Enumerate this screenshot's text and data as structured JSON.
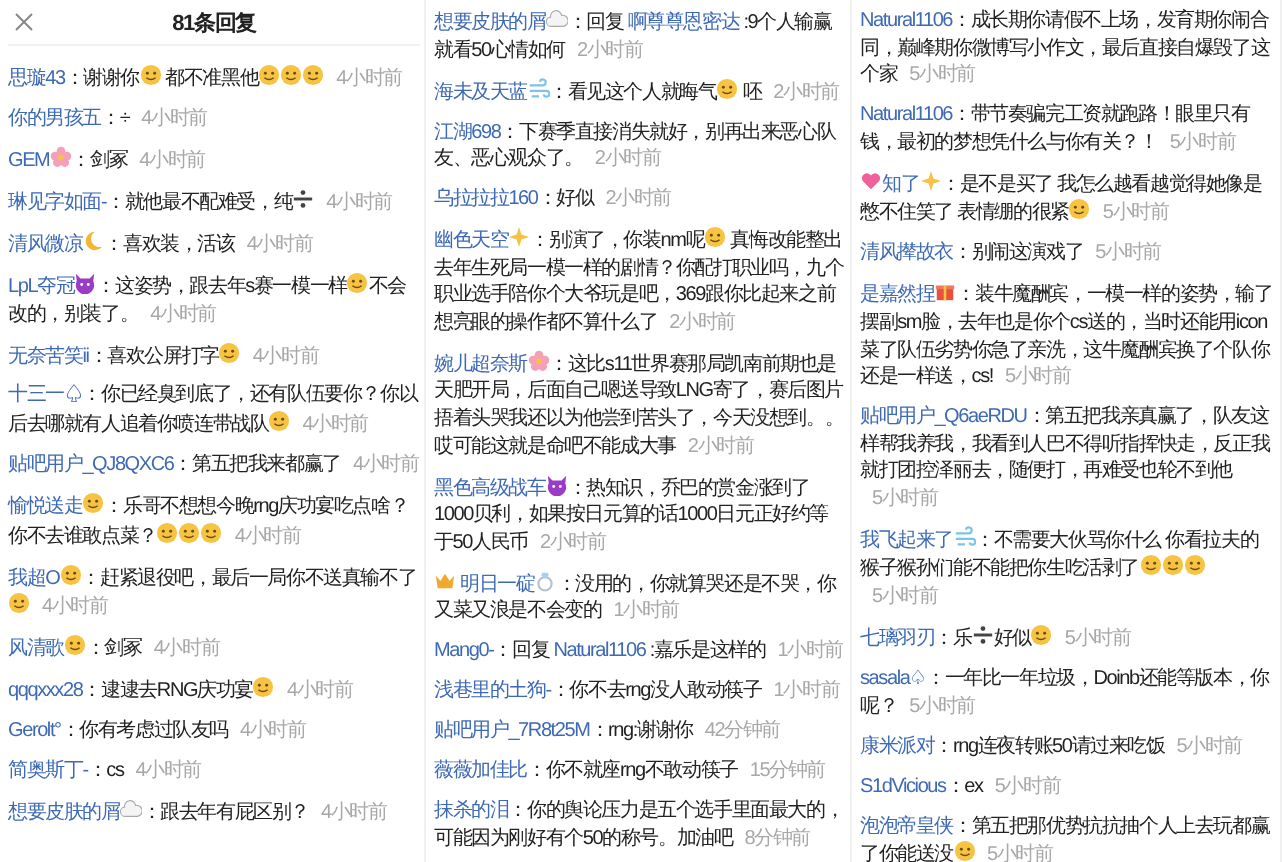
{
  "header": {
    "title": "81条回复"
  },
  "columns": [
    {
      "comments": [
        {
          "user": [
            "思璇43"
          ],
          "body": [
            "：谢谢你",
            {
              "kind": "face"
            },
            " 都不准黑他",
            {
              "kind": "face"
            },
            {
              "kind": "face"
            },
            {
              "kind": "face"
            }
          ],
          "time": "4小时前"
        },
        {
          "user": [
            "你的男孩五"
          ],
          "body": [
            "：÷"
          ],
          "time": "4小时前"
        },
        {
          "user": [
            "GEM",
            {
              "kind": "flower"
            }
          ],
          "body": [
            "：剑冢"
          ],
          "time": "4小时前"
        },
        {
          "user": [
            "琳见字如面-"
          ],
          "body": [
            "：就他最不配难受，纯",
            {
              "kind": "divide"
            }
          ],
          "time": "4小时前"
        },
        {
          "user": [
            "清风微凉",
            {
              "kind": "moon"
            }
          ],
          "body": [
            "：喜欢装，活该"
          ],
          "time": "4小时前"
        },
        {
          "user": [
            "LpL夺冠",
            {
              "kind": "devil"
            }
          ],
          "body": [
            "：这姿势，跟去年s赛一模一样",
            {
              "kind": "face"
            },
            "不会改的，别装了。"
          ],
          "time": "4小时前"
        },
        {
          "user": [
            "无奈苦笑ii"
          ],
          "body": [
            "：喜欢公屏打字",
            {
              "kind": "face"
            }
          ],
          "time": "4小时前"
        },
        {
          "user": [
            "十三一♤"
          ],
          "body": [
            "：你已经臭到底了，还有队伍要你？你以后去哪就有人追着你喷连带战队",
            {
              "kind": "face"
            }
          ],
          "time": "4小时前"
        },
        {
          "user": [
            "贴吧用户_QJ8QXC6"
          ],
          "body": [
            "：第五把我来都赢了"
          ],
          "time": "4小时前"
        },
        {
          "user": [
            "愉悦送走",
            {
              "kind": "face"
            }
          ],
          "body": [
            "：乐哥不想想今晚rng庆功宴吃点啥？你不去谁敢点菜？",
            {
              "kind": "face"
            },
            {
              "kind": "face"
            },
            {
              "kind": "face"
            }
          ],
          "time": "4小时前"
        },
        {
          "user": [
            "我超O",
            {
              "kind": "face"
            }
          ],
          "body": [
            "：赶紧退役吧，最后一局你不送真输不了",
            {
              "kind": "face"
            }
          ],
          "time": "4小时前"
        },
        {
          "user": [
            "风清歌",
            {
              "kind": "face"
            }
          ],
          "body": [
            "：剑冢"
          ],
          "time": "4小时前"
        },
        {
          "user": [
            "qqqxxx28"
          ],
          "body": [
            "：逮逮去RNG庆功宴",
            {
              "kind": "face"
            }
          ],
          "time": "4小时前"
        },
        {
          "user": [
            "Gerolt°"
          ],
          "body": [
            "：你有考虑过队友吗"
          ],
          "time": "4小时前"
        },
        {
          "user": [
            "简奥斯丁-"
          ],
          "body": [
            "：cs"
          ],
          "time": "4小时前"
        },
        {
          "user": [
            "想要皮肤的屑",
            {
              "kind": "cloud"
            }
          ],
          "body": [
            "：跟去年有屁区别？"
          ],
          "time": "4小时前"
        }
      ]
    },
    {
      "comments": [
        {
          "user": [
            "想要皮肤的屑",
            {
              "kind": "cloud"
            }
          ],
          "body": [
            "：回复 ",
            {
              "kind": "mention",
              "text": "啊尊尊恩密达"
            },
            " :9个人输赢就看50心情如何"
          ],
          "time": "2小时前"
        },
        {
          "user": [
            "海未及天蓝",
            {
              "kind": "wind"
            }
          ],
          "body": [
            "：看见这个人就晦气",
            {
              "kind": "face"
            },
            " 呸"
          ],
          "time": "2小时前"
        },
        {
          "user": [
            "江湖698"
          ],
          "body": [
            "：下赛季直接消失就好，别再出来恶心队友、恶心观众了。"
          ],
          "time": "2小时前"
        },
        {
          "user": [
            "乌拉拉拉160"
          ],
          "body": [
            "：好似"
          ],
          "time": "2小时前"
        },
        {
          "user": [
            "幽色天空",
            {
              "kind": "sparkle"
            }
          ],
          "body": [
            "：别演了，你装nm呢",
            {
              "kind": "face"
            },
            " 真悔改能整出去年生死局一模一样的剧情？你配打职业吗，九个职业选手陪你个大爷玩是吧，369跟你比起来之前想亮眼的操作都不算什么了"
          ],
          "time": "2小时前"
        },
        {
          "user": [
            "婉儿超奈斯",
            {
              "kind": "flower"
            }
          ],
          "body": [
            "：这比s11世界赛那局凯南前期也是天肥开局，后面自己嗯送导致LNG寄了，赛后图片捂着头哭我还以为他尝到苦头了，今天没想到。。哎可能这就是命吧不能成大事"
          ],
          "time": "2小时前"
        },
        {
          "user": [
            "黑色高级战车",
            {
              "kind": "devil"
            }
          ],
          "body": [
            "：热知识，乔巴的赏金涨到了1000贝利，如果按日元算的话1000日元正好约等于50人民币"
          ],
          "time": "2小时前"
        },
        {
          "user": [
            {
              "kind": "crown"
            },
            " 明日一碇",
            {
              "kind": "ring"
            }
          ],
          "body": [
            "：没用的，你就算哭还是不哭，你又菜又浪是不会变的"
          ],
          "time": "1小时前"
        },
        {
          "user": [
            "Mang0-"
          ],
          "body": [
            "：回复 ",
            {
              "kind": "mention",
              "text": "Natural1106"
            },
            " :嘉乐是这样的"
          ],
          "time": "1小时前"
        },
        {
          "user": [
            "浅巷里的土狗-"
          ],
          "body": [
            "：你不去rng没人敢动筷子"
          ],
          "time": "1小时前"
        },
        {
          "user": [
            "贴吧用户_7R8t25M"
          ],
          "body": [
            "：rng:谢谢你"
          ],
          "time": "42分钟前"
        },
        {
          "user": [
            "薇薇加佳比"
          ],
          "body": [
            "：你不就座rng不敢动筷子"
          ],
          "time": "15分钟前"
        },
        {
          "user": [
            "抹杀的泪"
          ],
          "body": [
            "：你的舆论压力是五个选手里面最大的，可能因为刚好有个50的称号。加油吧"
          ],
          "time": "8分钟前"
        }
      ]
    },
    {
      "comments": [
        {
          "user": [
            "Natural1106"
          ],
          "body": [
            "：成长期你请假不上场，发育期你闹合同，巅峰期你微博写小作文，最后直接自爆毁了这个家"
          ],
          "time": "5小时前"
        },
        {
          "user": [
            "Natural1106"
          ],
          "body": [
            "：带节奏骗完工资就跑路！眼里只有钱，最初的梦想凭什么与你有关？！"
          ],
          "time": "5小时前"
        },
        {
          "user": [
            {
              "kind": "heart"
            },
            "知了",
            {
              "kind": "sparkle"
            }
          ],
          "body": [
            "：是不是买了 我怎么越看越觉得她像是憋不住笑了 表情绷的很紧",
            {
              "kind": "face"
            }
          ],
          "time": "5小时前"
        },
        {
          "user": [
            "清风撵故衣"
          ],
          "body": [
            "：别闹这演戏了"
          ],
          "time": "5小时前"
        },
        {
          "user": [
            "是嘉然捏",
            {
              "kind": "gift"
            }
          ],
          "body": [
            "：装牛魔酬宾，一模一样的姿势，输了摆副sm脸，去年也是你个cs送的，当时还能用icon菜了队伍劣势你急了亲洗，这牛魔酬宾换了个队你还是一样送，cs!"
          ],
          "time": "5小时前"
        },
        {
          "user": [
            "贴吧用户_Q6aeRDU"
          ],
          "body": [
            "：第五把我亲真赢了，队友这样帮我养我，我看到人巴不得听指挥快走，反正我就打团控泽丽去，随便打，再难受也轮不到他"
          ],
          "time": "5小时前"
        },
        {
          "user": [
            "我飞起来了",
            {
              "kind": "wind"
            }
          ],
          "body": [
            "：不需要大伙骂你什么 你看拉夫的猴子猴孙们能不能把你生吃活剥了",
            {
              "kind": "face"
            },
            {
              "kind": "face"
            },
            {
              "kind": "face"
            }
          ],
          "time": "5小时前"
        },
        {
          "user": [
            "七璃羽刃"
          ],
          "body": [
            "：乐",
            {
              "kind": "divide"
            },
            "好似",
            {
              "kind": "face"
            }
          ],
          "time": "5小时前"
        },
        {
          "user": [
            "sasala♤"
          ],
          "body": [
            "：一年比一年垃圾，Doinb还能等版本，你呢？"
          ],
          "time": "5小时前"
        },
        {
          "user": [
            "康米派对"
          ],
          "body": [
            "：rng连夜转账50请过来吃饭"
          ],
          "time": "5小时前"
        },
        {
          "user": [
            "S1dVicious"
          ],
          "body": [
            "：ex"
          ],
          "time": "5小时前"
        },
        {
          "user": [
            "泡泡帝皇侠"
          ],
          "body": [
            "：第五把那优势抗抗抽个人上去玩都赢了你能送没",
            {
              "kind": "face"
            }
          ],
          "time": "5小时前"
        }
      ]
    }
  ]
}
